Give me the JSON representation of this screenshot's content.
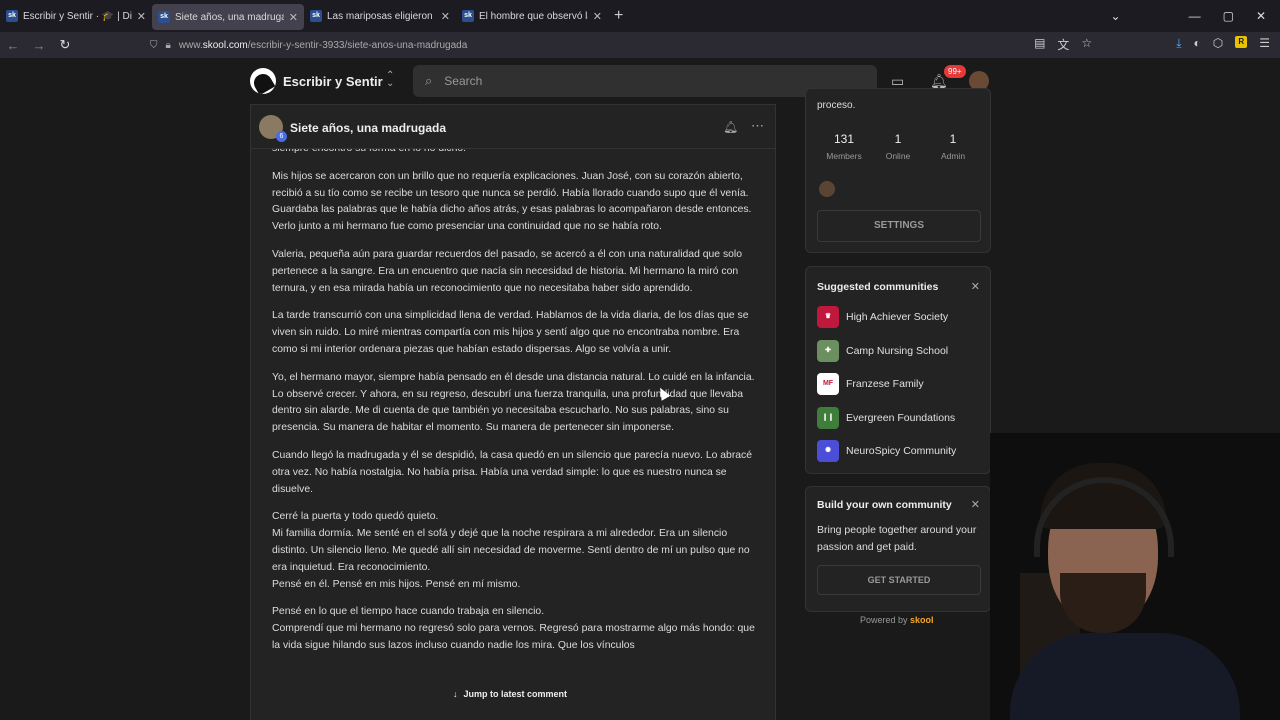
{
  "browser": {
    "tabs": [
      {
        "title": "Escribir y Sentir · 🎓 | Dinámica",
        "favicon": "sk"
      },
      {
        "title": "Siete años, una madrugada · Es",
        "favicon": "sk",
        "active": true
      },
      {
        "title": "Las mariposas eligieron IV · Esc",
        "favicon": "sk"
      },
      {
        "title": "El hombre que observó la luz I ·",
        "favicon": "sk"
      }
    ],
    "url_prefix": "www.",
    "url_host": "skool.com",
    "url_path": "/escribir-y-sentir-3933/siete-anos-una-madrugada"
  },
  "header": {
    "group_name": "Escribir y Sentir",
    "search_placeholder": "Search",
    "notif_badge": "99+"
  },
  "post": {
    "title": "Siete años, una madrugada",
    "level": "6",
    "paragraphs": [
      {
        "text": "siempre encontró su forma en lo no dicho.",
        "tight": false
      },
      {
        "text": "Mis hijos se acercaron con un brillo que no requería explicaciones. Juan José, con su corazón abierto, recibió a su tío como se recibe un tesoro que nunca se perdió. Había llorado cuando supo que él venía. Guardaba las palabras que le había dicho años atrás, y esas palabras lo acompañaron desde entonces. Verlo junto a mi hermano fue como presenciar una continuidad que no se había roto.",
        "tight": false
      },
      {
        "text": "Valeria, pequeña aún para guardar recuerdos del pasado, se acercó a él con una naturalidad que solo pertenece a la sangre. Era un encuentro que nacía sin necesidad de historia. Mi hermano la miró con ternura, y en esa mirada había un reconocimiento que no necesitaba haber sido aprendido.",
        "tight": false
      },
      {
        "text": "La tarde transcurrió con una simplicidad llena de verdad. Hablamos de la vida diaria, de los días que se viven sin ruido. Lo miré mientras compartía con mis hijos y sentí algo que no encontraba nombre. Era como si mi interior ordenara piezas que habían estado dispersas. Algo se volvía a unir.",
        "tight": false
      },
      {
        "text": "Yo, el hermano mayor, siempre había pensado en él desde una distancia natural. Lo cuidé en la infancia. Lo observé crecer. Y ahora, en su regreso, descubrí una fuerza tranquila, una profundidad que llevaba dentro sin alarde. Me di cuenta de que también yo necesitaba escucharlo. No sus palabras, sino su presencia. Su manera de habitar el momento. Su manera de pertenecer sin imponerse.",
        "tight": false
      },
      {
        "text": "Cuando llegó la madrugada y él se despidió, la casa quedó en un silencio que parecía nuevo. Lo abracé otra vez. No había nostalgia. No había prisa. Había una verdad simple: lo que es nuestro nunca se disuelve.",
        "tight": false
      },
      {
        "text": "Cerré la puerta y todo quedó quieto.",
        "tight": true
      },
      {
        "text": "Mi familia dormía. Me senté en el sofá y dejé que la noche respirara a mi alrededor. Era un silencio distinto. Un silencio lleno. Me quedé allí sin necesidad de moverme. Sentí dentro de mí un pulso que no era inquietud. Era reconocimiento.",
        "tight": true
      },
      {
        "text": "Pensé en él. Pensé en mis hijos. Pensé en mí mismo.",
        "tight": false
      },
      {
        "text": "Pensé en lo que el tiempo hace cuando trabaja en silencio.",
        "tight": true
      },
      {
        "text": "Comprendí que mi hermano no regresó solo para vernos. Regresó para mostrarme algo más hondo: que la vida sigue hilando sus lazos incluso cuando nadie los mira. Que los vínculos",
        "tight": false
      }
    ],
    "jump_label": "Jump to latest comment"
  },
  "sidebar": {
    "process_text": "proceso.",
    "stats": [
      {
        "value": "131",
        "label": "Members"
      },
      {
        "value": "1",
        "label": "Online"
      },
      {
        "value": "1",
        "label": "Admin"
      }
    ],
    "settings_label": "SETTINGS",
    "suggested_title": "Suggested communities",
    "communities": [
      {
        "name": "High Achiever Society",
        "color": "#c0183c",
        "glyph": "♛"
      },
      {
        "name": "Camp Nursing School",
        "color": "#6b8f5e",
        "glyph": "✚"
      },
      {
        "name": "Franzese Family",
        "color": "#ffffff",
        "glyph": "MF"
      },
      {
        "name": "Evergreen Foundations",
        "color": "#3f7d3a",
        "glyph": "❙❙"
      },
      {
        "name": "NeuroSpicy Community",
        "color": "#4b4fd8",
        "glyph": "✺"
      }
    ],
    "build_title": "Build your own community",
    "build_desc": "Bring people together around your passion and get paid.",
    "get_started_label": "GET STARTED",
    "powered_prefix": "Powered by",
    "powered_brand": "skool"
  }
}
